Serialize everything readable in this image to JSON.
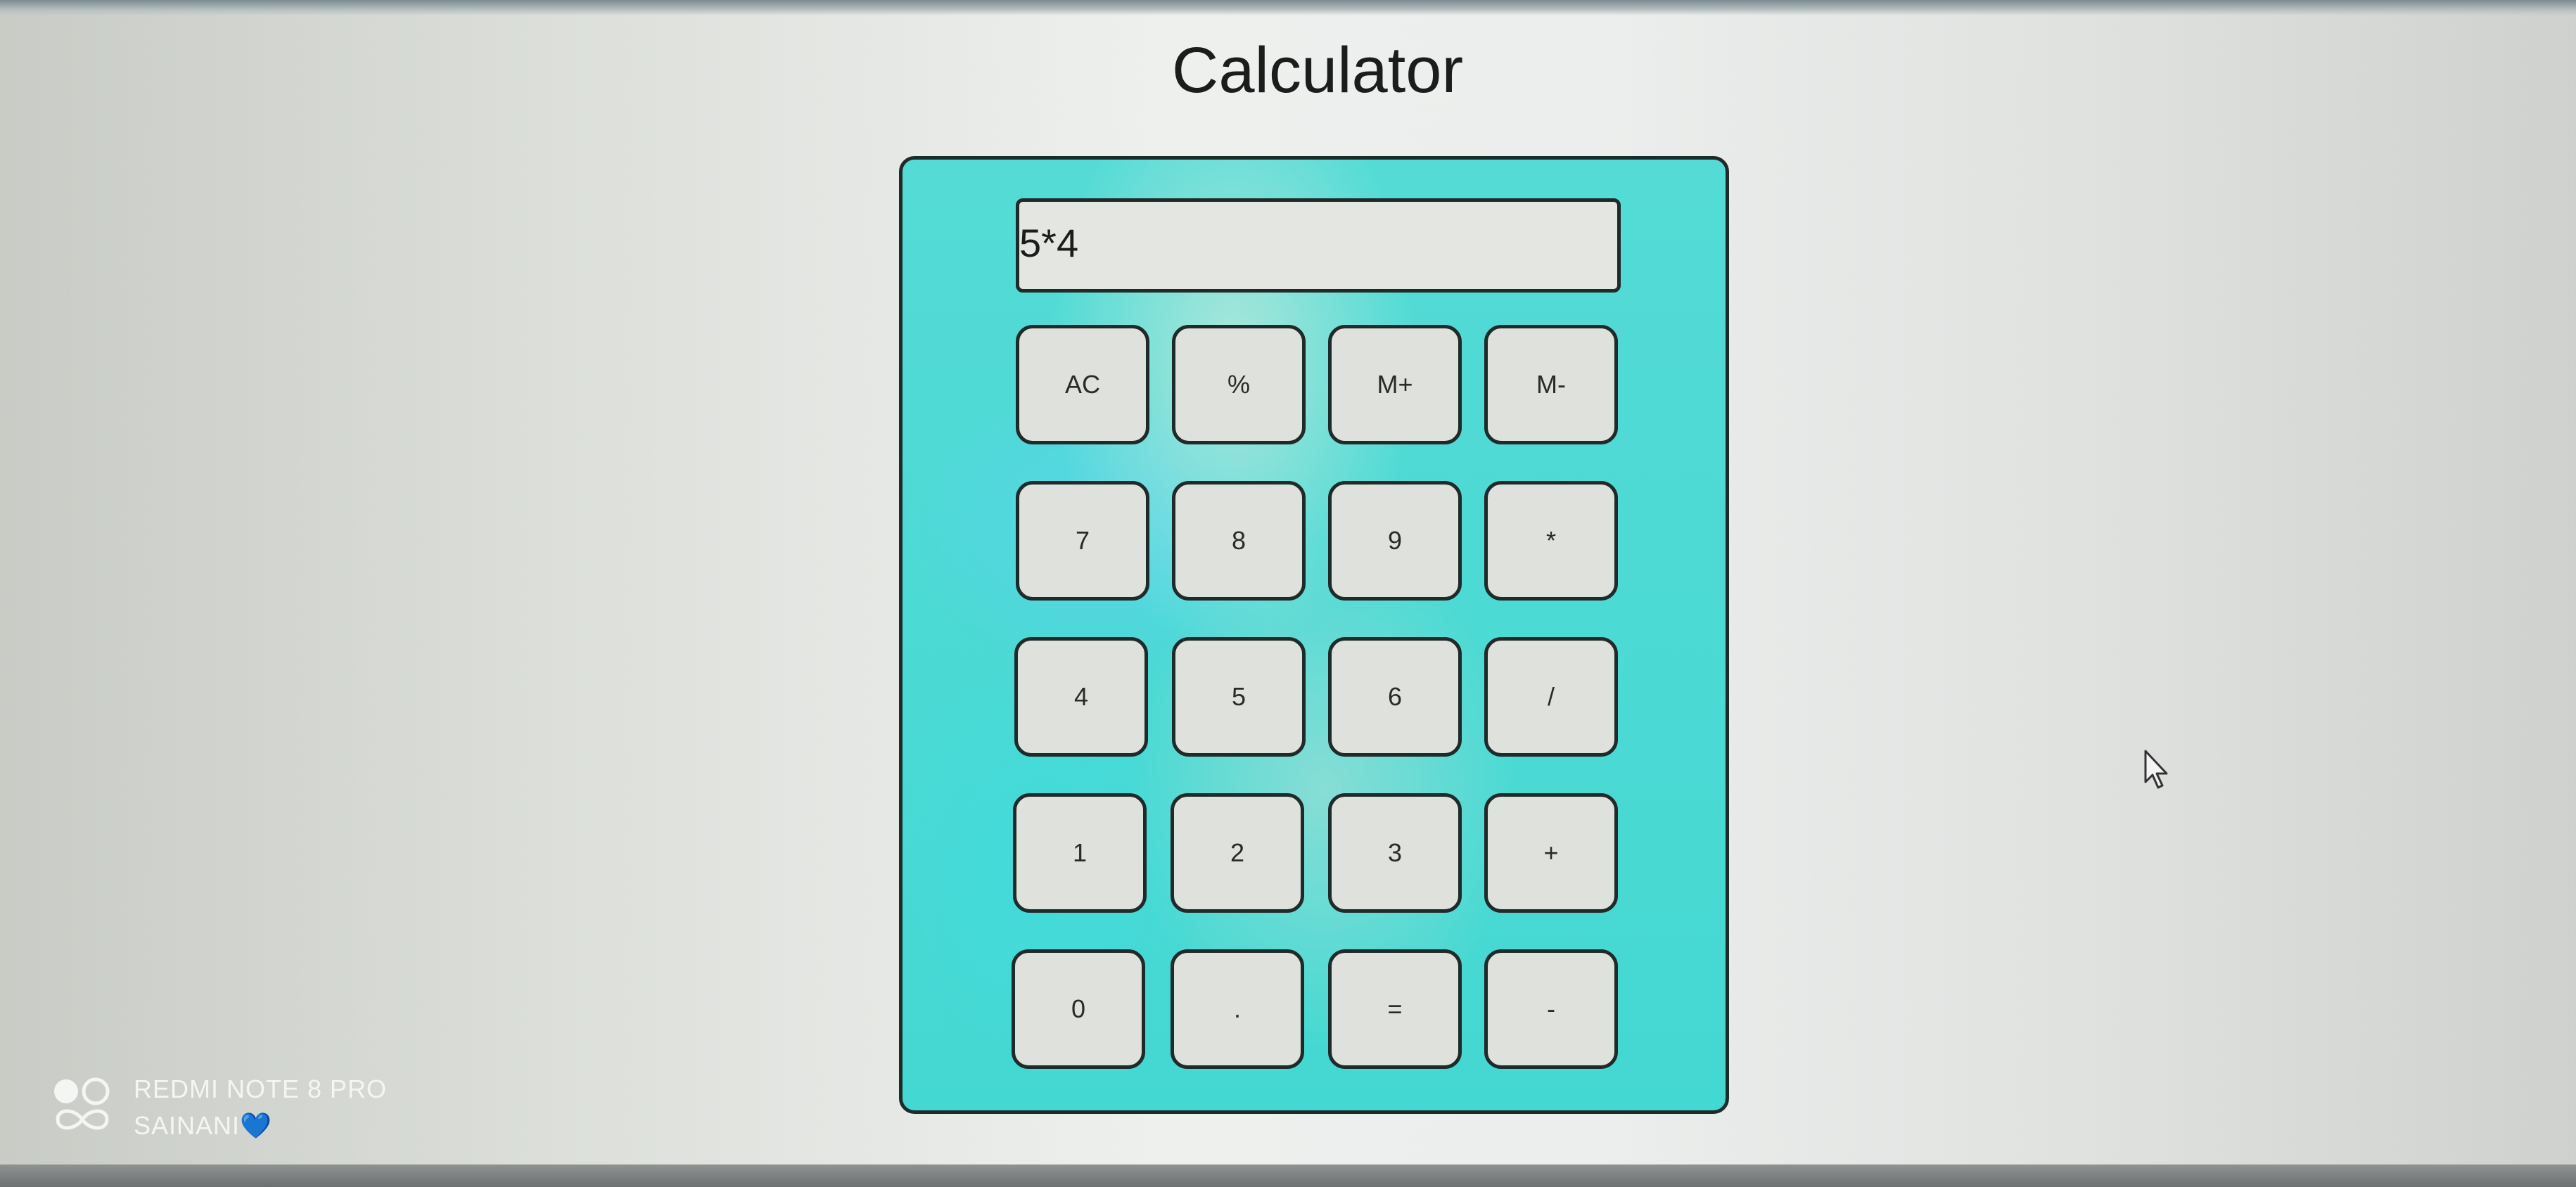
{
  "page": {
    "title": "Calculator"
  },
  "calculator": {
    "display_value": "5*4",
    "keys": [
      {
        "label": "AC",
        "name": "key-ac"
      },
      {
        "label": "%",
        "name": "key-percent"
      },
      {
        "label": "M+",
        "name": "key-memory-plus"
      },
      {
        "label": "M-",
        "name": "key-memory-minus"
      },
      {
        "label": "7",
        "name": "key-7"
      },
      {
        "label": "8",
        "name": "key-8"
      },
      {
        "label": "9",
        "name": "key-9"
      },
      {
        "label": "*",
        "name": "key-multiply"
      },
      {
        "label": "4",
        "name": "key-4"
      },
      {
        "label": "5",
        "name": "key-5"
      },
      {
        "label": "6",
        "name": "key-6"
      },
      {
        "label": "/",
        "name": "key-divide"
      },
      {
        "label": "1",
        "name": "key-1"
      },
      {
        "label": "2",
        "name": "key-2"
      },
      {
        "label": "3",
        "name": "key-3"
      },
      {
        "label": "+",
        "name": "key-plus"
      },
      {
        "label": "0",
        "name": "key-0"
      },
      {
        "label": ".",
        "name": "key-decimal"
      },
      {
        "label": "=",
        "name": "key-equals"
      },
      {
        "label": "-",
        "name": "key-minus"
      }
    ]
  },
  "watermark": {
    "device": "REDMI NOTE 8 PRO",
    "author": "SAINANI💙"
  },
  "colors": {
    "panel": "#44d8d2",
    "key_face": "#dfe1dc",
    "border": "#1f2a2a"
  }
}
